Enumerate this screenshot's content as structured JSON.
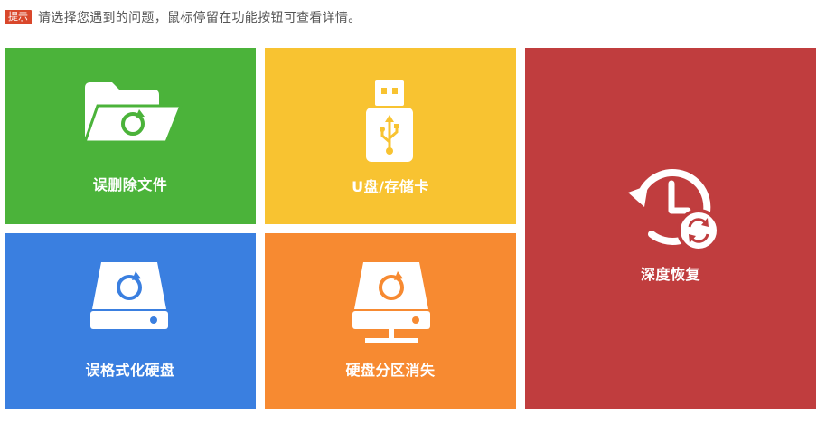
{
  "hint": {
    "badge": "提示",
    "text": "请选择您遇到的问题，鼠标停留在功能按钮可查看详情。"
  },
  "tiles": {
    "deleted_files": {
      "label": "误删除文件",
      "color": "#4bb33a",
      "icon": "folder-recovery-icon"
    },
    "usb_card": {
      "label": "U盘/存储卡",
      "color": "#f8c331",
      "icon": "usb-drive-icon"
    },
    "deep_recovery": {
      "label": "深度恢复",
      "color": "#c03d3e",
      "icon": "clock-restore-icon"
    },
    "format_disk": {
      "label": "误格式化硬盘",
      "color": "#3a7fe0",
      "icon": "hard-disk-icon"
    },
    "partition_lost": {
      "label": "硬盘分区消失",
      "color": "#f78a31",
      "icon": "disk-partition-icon"
    }
  }
}
